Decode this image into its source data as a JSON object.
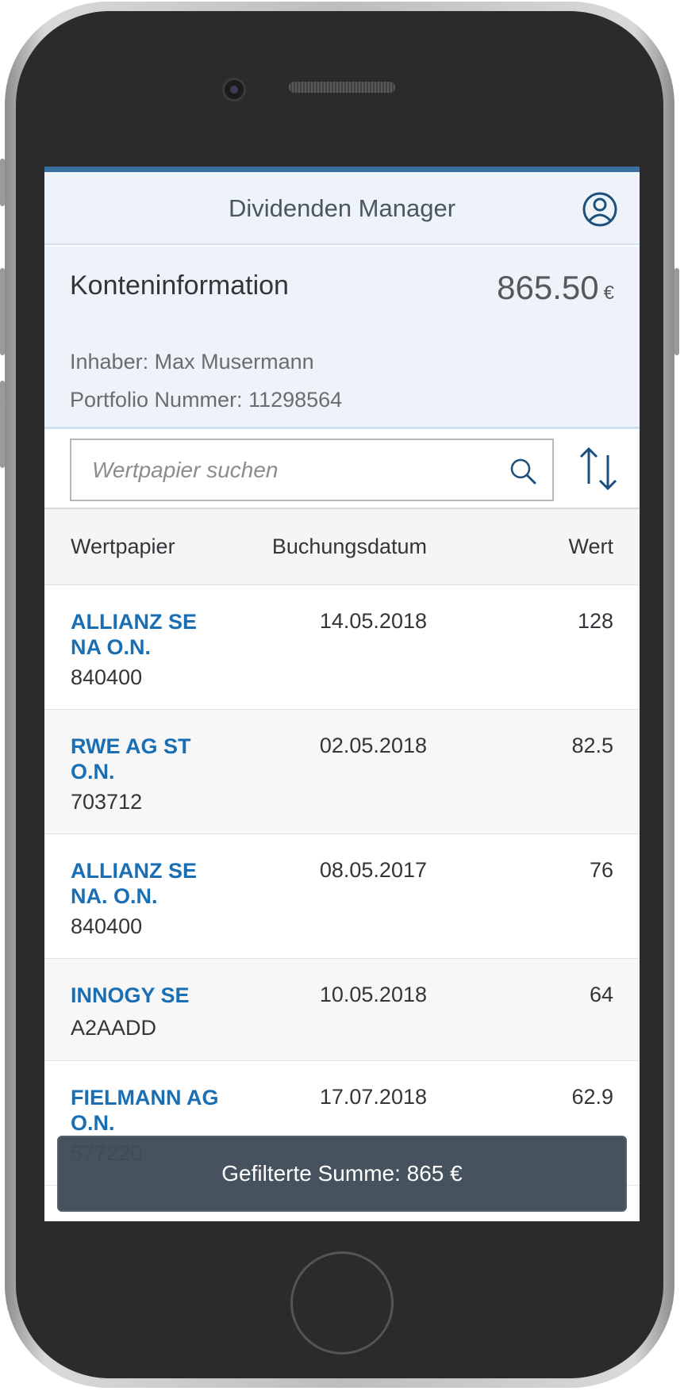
{
  "app": {
    "title": "Dividenden Manager",
    "accent_color": "#3b6fa0",
    "user_icon": "user-circle-icon"
  },
  "account": {
    "title": "Konteninformation",
    "balance": "865.50",
    "currency": "€",
    "owner_label": "Inhaber:",
    "owner_name": "Max Musermann",
    "portfolio_label": "Portfolio Nummer:",
    "portfolio_number": "11298564"
  },
  "search": {
    "placeholder": "Wertpapier suchen",
    "value": "",
    "icon": "search-icon"
  },
  "sort": {
    "icon": "sort-icon"
  },
  "table": {
    "columns": [
      "Wertpapier",
      "Buchungsdatum",
      "Wert"
    ],
    "rows": [
      {
        "name": "ALLIANZ SE NA O.N.",
        "wkn": "840400",
        "date": "14.05.2018",
        "value": "128"
      },
      {
        "name": "RWE AG ST O.N.",
        "wkn": "703712",
        "date": "02.05.2018",
        "value": "82.5"
      },
      {
        "name": "ALLIANZ SE NA. O.N.",
        "wkn": "840400",
        "date": "08.05.2017",
        "value": "76"
      },
      {
        "name": "INNOGY SE",
        "wkn": "A2AADD",
        "date": "10.05.2018",
        "value": "64"
      },
      {
        "name": "FIELMANN AG O.N.",
        "wkn": "577220",
        "date": "17.07.2018",
        "value": "62.9"
      }
    ]
  },
  "toast": {
    "message": "Gefilterte Summe: 865 €"
  },
  "colors": {
    "link": "#1a6fb4",
    "header_bg": "#edf3f8",
    "toast_bg": "#404c58"
  }
}
